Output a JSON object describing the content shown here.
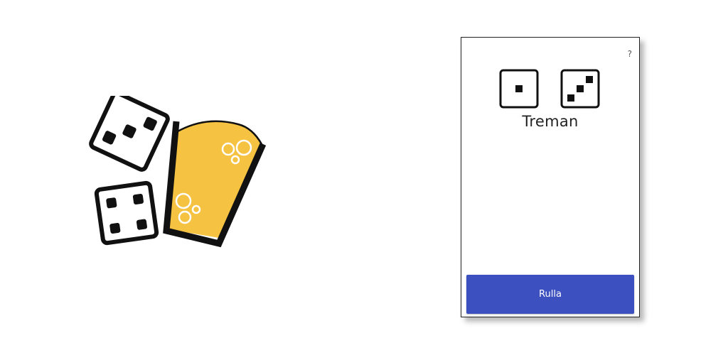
{
  "app": {
    "logo_icon": "dice-and-beer-glass",
    "colors": {
      "beer": "#f5c242",
      "button": "#3d50c0",
      "ink": "#111111"
    }
  },
  "game": {
    "help_label": "?",
    "dice": [
      {
        "icon": "die-face-one",
        "value": 1
      },
      {
        "icon": "die-face-three",
        "value": 3
      }
    ],
    "result_label": "Treman",
    "roll_button_label": "Rulla"
  }
}
